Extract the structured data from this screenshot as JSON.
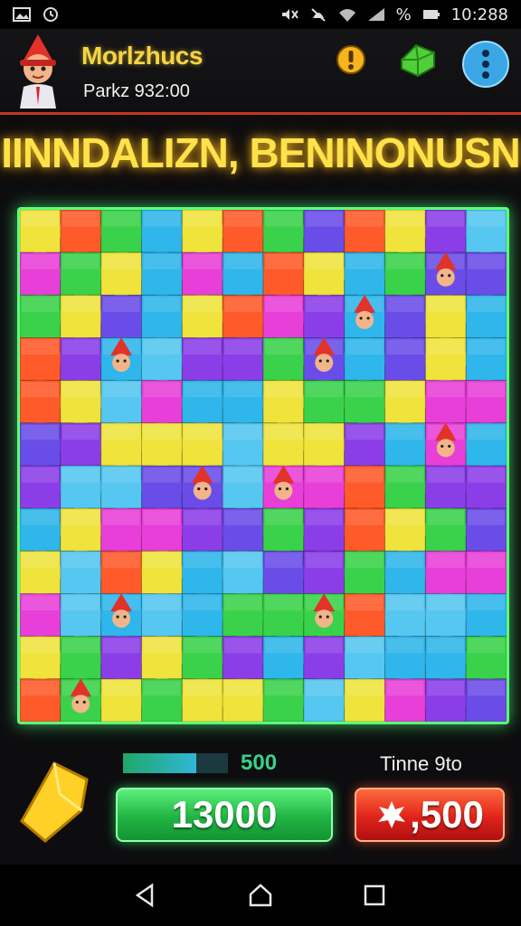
{
  "status_bar": {
    "time": "10:288",
    "icons": [
      "image-icon",
      "alarm-icon",
      "mute-icon",
      "silent-icon",
      "wifi-icon",
      "signal-icon",
      "battery-icon"
    ],
    "battery_text": "%"
  },
  "header": {
    "player_name": "Morlzhucs",
    "player_sub": "Parkz 932:00",
    "buttons": [
      "hint-icon",
      "gem-icon",
      "menu-icon"
    ]
  },
  "title": "IINNDALIZN, BENINONUSN",
  "board": {
    "rows": 12,
    "cols": 12,
    "palette": [
      "#3ad24a",
      "#2fb6ea",
      "#8b3ee8",
      "#f0e33c",
      "#ff5a2a",
      "#e83fd8",
      "#55c7f0",
      "#6a4de8"
    ],
    "frame_color": "#5dff7a"
  },
  "footer": {
    "progress_value": "500",
    "progress_fraction": 0.7,
    "timer_label": "Tinne 9to",
    "score_button": "13000",
    "bonus_button": ",500"
  },
  "nav_bar": {
    "buttons": [
      "back-icon",
      "home-icon",
      "recents-icon"
    ]
  },
  "colors": {
    "accent_yellow": "#ffe14a",
    "header_rule": "#c8361f",
    "score_green": "#21b443",
    "bonus_red": "#e0231b",
    "progress_text": "#35d38a"
  }
}
